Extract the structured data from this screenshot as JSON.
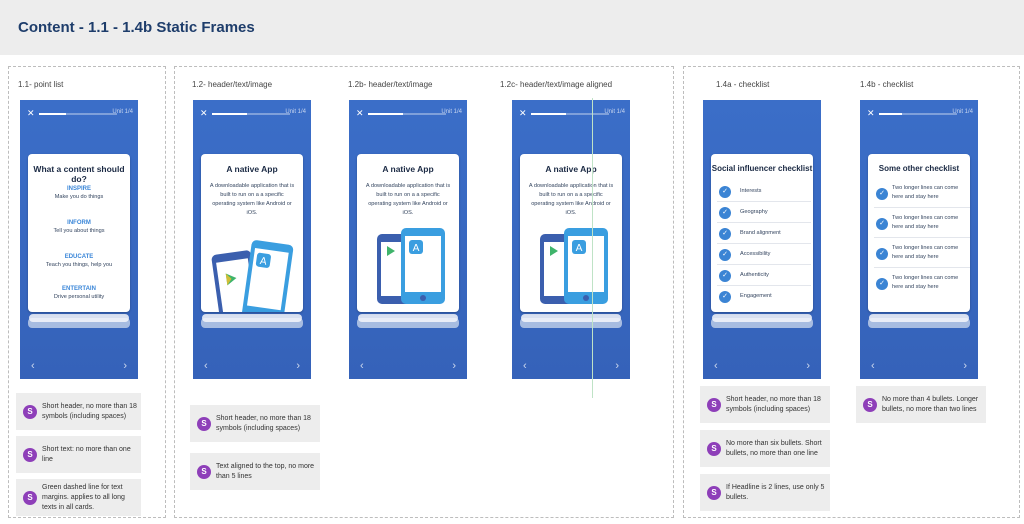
{
  "page": {
    "title": "Content - 1.1 - 1.4b Static Frames"
  },
  "colors": {
    "phone_blue": "#3b6ec8",
    "accent_blue": "#3a86d8",
    "badge_purple": "#8e3fb9",
    "note_bg": "#ededed"
  },
  "phone_chrome": {
    "close_icon": "✕",
    "unit_label": "Unit 1/4",
    "prev_icon": "‹",
    "next_icon": "›"
  },
  "sections": [
    {
      "label": "1.1- point list"
    },
    {
      "label": "1.2- header/text/image"
    },
    {
      "label": "1.2b- header/text/image"
    },
    {
      "label": "1.2c- header/text/image aligned"
    },
    {
      "label": "1.4a - checklist"
    },
    {
      "label": "1.4b - checklist"
    }
  ],
  "cards": {
    "point_list": {
      "title": "What a content should do?",
      "points": [
        {
          "heading": "INSPIRE",
          "text": "Make you do things"
        },
        {
          "heading": "INFORM",
          "text": "Tell you about things"
        },
        {
          "heading": "EDUCATE",
          "text": "Teach you things, help you"
        },
        {
          "heading": "ENTERTAIN",
          "text": "Drive personal utility"
        }
      ]
    },
    "native_app": {
      "title": "A native App",
      "body": "A downloadable application that is built to run on a a specific operating system like Android or iOS."
    },
    "checklist_a": {
      "title": "Social influencer checklist",
      "items": [
        "Interests",
        "Geography",
        "Brand alignment",
        "Accessibility",
        "Authenticity",
        "Engagement"
      ]
    },
    "checklist_b": {
      "title": "Some other checklist",
      "items": [
        "Two longer lines can come here and stay here",
        "Two longer lines can come here and stay here",
        "Two longer lines can come here and stay here",
        "Two longer lines can come here and stay here"
      ]
    }
  },
  "notes": {
    "group1": [
      "Short header, no more than 18 symbols (including spaces)",
      "Short text: no more than one line",
      "Green dashed line for text margins. applies to all long texts in all cards."
    ],
    "group2": [
      "Short header, no more than 18 symbols (including spaces)",
      "Text aligned to the top, no more than 5 lines"
    ],
    "group3": [
      "Short header, no more than 18 symbols (including spaces)",
      "No more than six bullets. Short bullets, no more than one line",
      "If Headline is 2 lines, use only 5 bullets."
    ],
    "group4": [
      "No more than 4 bullets. Longer bullets, no more than two lines"
    ],
    "badge": "S"
  }
}
